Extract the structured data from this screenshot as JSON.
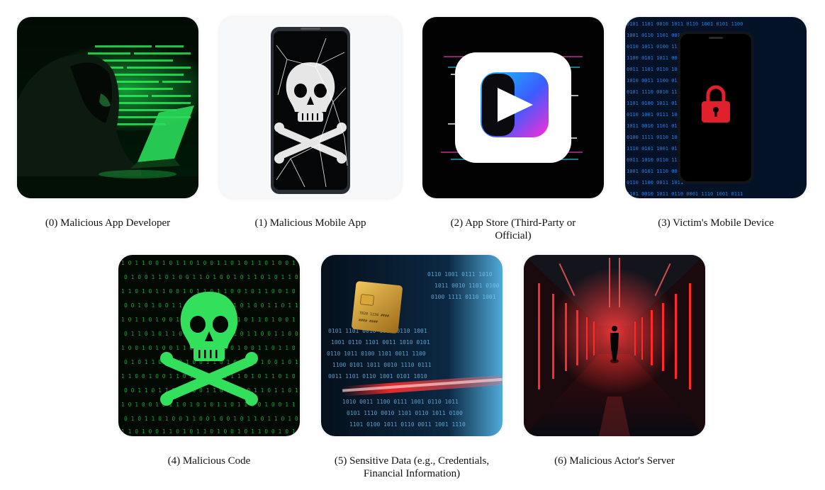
{
  "items": [
    {
      "caption": "(0) Malicious App Developer",
      "icon": "hooded-hacker-icon"
    },
    {
      "caption": "(1) Malicious Mobile App",
      "icon": "cracked-phone-skull-icon"
    },
    {
      "caption": "(2) App Store (Third-Party or Official)",
      "icon": "app-store-play-icon"
    },
    {
      "caption": "(3) Victim's Mobile Device",
      "icon": "locked-phone-icon"
    },
    {
      "caption": "(4) Malicious Code",
      "icon": "binary-skull-icon"
    },
    {
      "caption": "(5) Sensitive Data (e.g., Credentials, Financial Information)",
      "icon": "credit-card-data-icon"
    },
    {
      "caption": "(6) Malicious Actor's Server",
      "icon": "server-corridor-icon"
    }
  ],
  "colors": {
    "hacker_green": "#1fd34a",
    "data_blue": "#1e90ff",
    "lock_red": "#e0202a",
    "server_red": "#ff2a2a"
  }
}
